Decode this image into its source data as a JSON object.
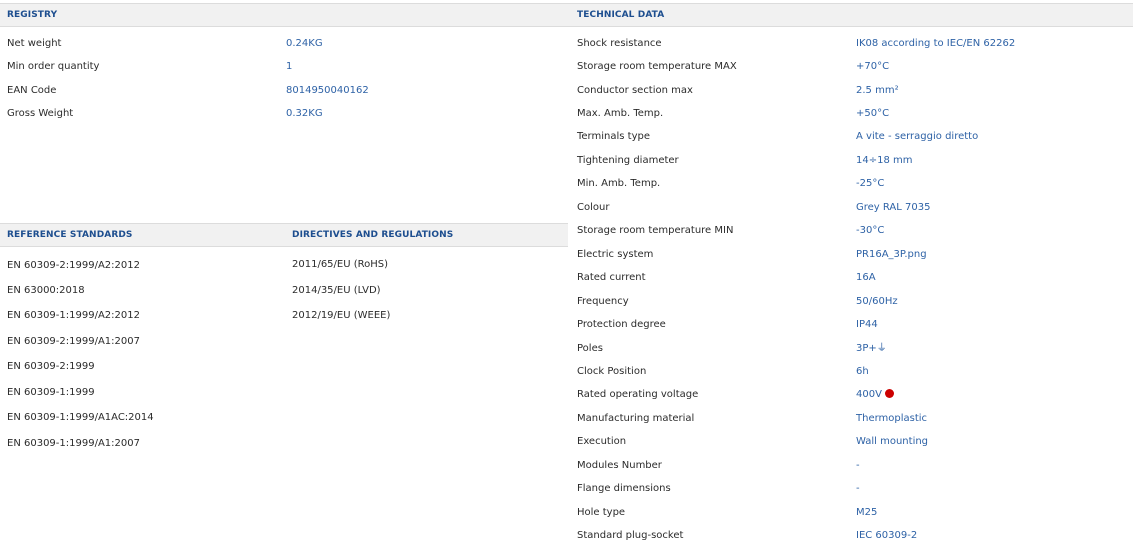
{
  "registry": {
    "header": "REGISTRY",
    "rows": [
      {
        "label": "Net weight",
        "value": "0.24KG"
      },
      {
        "label": "Min order quantity",
        "value": "1"
      },
      {
        "label": "EAN Code",
        "value": "8014950040162"
      },
      {
        "label": "Gross Weight",
        "value": "0.32KG"
      }
    ]
  },
  "technical": {
    "header": "TECHNICAL DATA",
    "rows": [
      {
        "label": "Shock resistance",
        "value": "IK08 according to IEC/EN 62262"
      },
      {
        "label": "Storage room temperature MAX",
        "value": "+70°C"
      },
      {
        "label": "Conductor section max",
        "value": "2.5 mm²"
      },
      {
        "label": "Max. Amb. Temp.",
        "value": "+50°C"
      },
      {
        "label": "Terminals type",
        "value": "A vite - serraggio diretto"
      },
      {
        "label": "Tightening diameter",
        "value": "14÷18 mm"
      },
      {
        "label": "Min. Amb. Temp.",
        "value": "-25°C"
      },
      {
        "label": "Colour",
        "value": "Grey RAL 7035"
      },
      {
        "label": "Storage room temperature MIN",
        "value": "-30°C"
      },
      {
        "label": "Electric system",
        "value": "PR16A_3P.png"
      },
      {
        "label": "Rated current",
        "value": "16A"
      },
      {
        "label": "Frequency",
        "value": "50/60Hz"
      },
      {
        "label": "Protection degree",
        "value": "IP44"
      },
      {
        "label": "Poles",
        "value": "3P+⏚"
      },
      {
        "label": "Clock Position",
        "value": "6h"
      },
      {
        "label": "Rated operating voltage",
        "value": "400V"
      },
      {
        "label": "Manufacturing material",
        "value": "Thermoplastic"
      },
      {
        "label": "Execution",
        "value": "Wall mounting"
      },
      {
        "label": "Modules Number",
        "value": "-"
      },
      {
        "label": "Flange dimensions",
        "value": "-"
      },
      {
        "label": "Hole type",
        "value": "M25"
      },
      {
        "label": "Standard plug-socket",
        "value": "IEC 60309-2"
      }
    ],
    "voltage_indicator_color": "#cc0000"
  },
  "reference_standards": {
    "header": "REFERENCE STANDARDS",
    "items": [
      "EN 60309-2:1999/A2:2012",
      "EN 63000:2018",
      "EN 60309-1:1999/A2:2012",
      "EN 60309-2:1999/A1:2007",
      "EN 60309-2:1999",
      "EN 60309-1:1999",
      "EN 60309-1:1999/A1AC:2014",
      "EN 60309-1:1999/A1:2007"
    ]
  },
  "directives": {
    "header": "DIRECTIVES AND REGULATIONS",
    "items": [
      "2011/65/EU (RoHS)",
      "2014/35/EU (LVD)",
      "2012/19/EU (WEEE)"
    ]
  },
  "colors": {
    "header_text": "#1d4e8f",
    "value_text": "#2e62a6",
    "header_bg": "#f1f1f1"
  }
}
